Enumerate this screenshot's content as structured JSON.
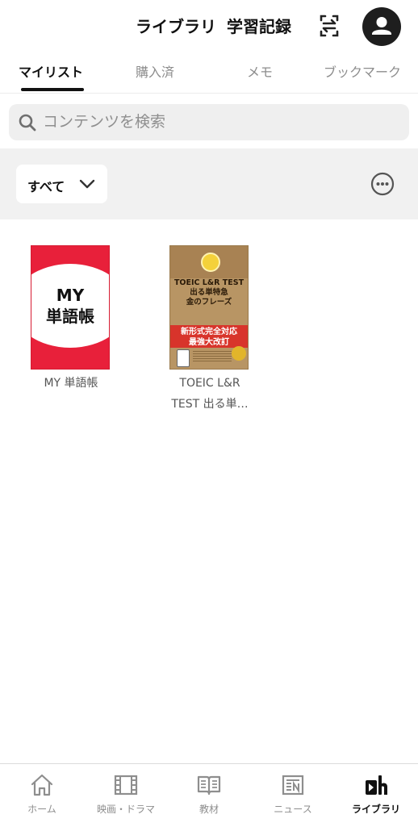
{
  "header": {
    "title_library": "ライブラリ",
    "title_study": "学習記録"
  },
  "tabs": [
    {
      "label": "マイリスト",
      "active": true
    },
    {
      "label": "購入済",
      "active": false
    },
    {
      "label": "メモ",
      "active": false
    },
    {
      "label": "ブックマーク",
      "active": false
    }
  ],
  "search": {
    "placeholder": "コンテンツを検索"
  },
  "filter": {
    "selected": "すべて"
  },
  "items": [
    {
      "cover_text_1": "MY",
      "cover_text_2": "単語帳",
      "title_line1": "MY 単語帳",
      "title_line2": ""
    },
    {
      "cover_headline": "TOEIC L&R TEST\n出る単特急\n金のフレーズ",
      "cover_banner": "新形式完全対応\n最強大改訂",
      "title_line1": "TOEIC L&R",
      "title_line2": "TEST 出る単…"
    }
  ],
  "bottom_nav": [
    {
      "label": "ホーム",
      "icon": "home-icon",
      "active": false
    },
    {
      "label": "映画・ドラマ",
      "icon": "film-icon",
      "active": false
    },
    {
      "label": "教材",
      "icon": "book-icon",
      "active": false
    },
    {
      "label": "ニュース",
      "icon": "news-icon",
      "active": false
    },
    {
      "label": "ライブラリ",
      "icon": "library-icon",
      "active": true
    }
  ],
  "colors": {
    "accent": "#111111",
    "inactive": "#8e8e8e",
    "my_cover_red": "#e8203a",
    "filter_bg": "#f1f1f1"
  }
}
